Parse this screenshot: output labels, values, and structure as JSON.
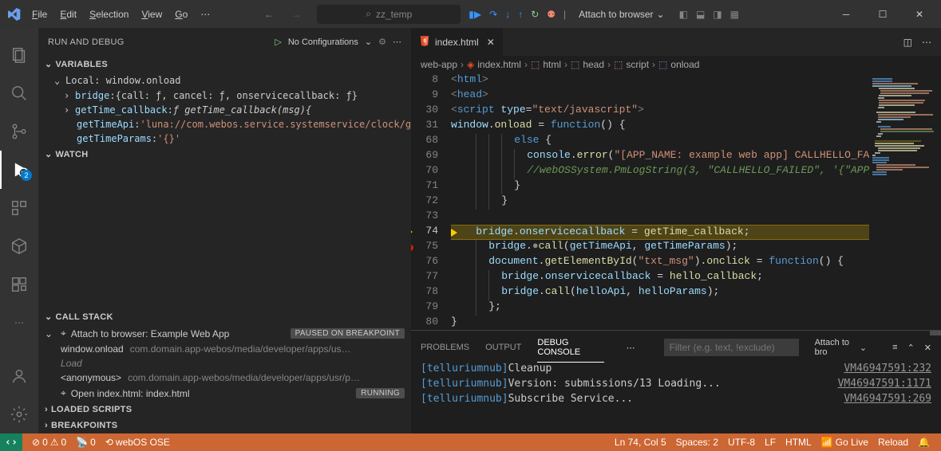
{
  "menu": {
    "file": "File",
    "edit": "Edit",
    "selection": "Selection",
    "view": "View",
    "go": "Go"
  },
  "search_placeholder": "zz_temp",
  "attach_label": "Attach to browser",
  "sidebar": {
    "title": "RUN AND DEBUG",
    "no_config": "No Configurations",
    "sections": {
      "variables": "VARIABLES",
      "watch": "WATCH",
      "callstack": "CALL STACK",
      "loaded_scripts": "LOADED SCRIPTS",
      "breakpoints": "BREAKPOINTS"
    },
    "scope": "Local: window.onload",
    "vars": [
      {
        "name": "bridge",
        "val": "{call: ƒ, cancel: ƒ, onservicecallback: ƒ}",
        "expandable": true
      },
      {
        "name": "getTime_callback",
        "val": "ƒ getTime_callback(msg){",
        "expandable": true
      },
      {
        "name": "getTimeApi",
        "val": "'luna://com.webos.service.systemservice/clock/g…",
        "indent": true,
        "str": true
      },
      {
        "name": "getTimeParams",
        "val": "'{}'",
        "indent": true,
        "str": true
      }
    ],
    "callstack": {
      "target": "Attach to browser: Example Web App",
      "badge": "PAUSED ON BREAKPOINT",
      "frames": [
        {
          "fn": "window.onload",
          "loc": "com.domain.app-webos/media/developer/apps/us…"
        },
        {
          "fn": "Load",
          "em": true
        },
        {
          "fn": "<anonymous>",
          "loc": "com.domain.app-webos/media/developer/apps/usr/p…"
        }
      ],
      "open_label": "Open index.html: index.html",
      "running_badge": "RUNNING"
    }
  },
  "tab": {
    "name": "index.html"
  },
  "breadcrumb": [
    "web-app",
    "index.html",
    "html",
    "head",
    "script",
    "onload"
  ],
  "code": {
    "line_nums": [
      "8",
      "9",
      "30",
      "31",
      "68",
      "69",
      "70",
      "71",
      "72",
      "73",
      "74",
      "75",
      "76",
      "77",
      "78",
      "79",
      "80"
    ],
    "current_line": "74"
  },
  "panel": {
    "tabs": {
      "problems": "PROBLEMS",
      "output": "OUTPUT",
      "debug_console": "DEBUG CONSOLE"
    },
    "filter_placeholder": "Filter (e.g. text, !exclude)",
    "attach_sel": "Attach to bro",
    "console": [
      {
        "tag": "[telluriumnub]",
        "msg": " Cleanup",
        "loc": "VM46947591:232"
      },
      {
        "tag": "[telluriumnub]",
        "msg": " Version: submissions/13 Loading...",
        "loc": "VM46947591:1171"
      },
      {
        "tag": "[telluriumnub]",
        "msg": " Subscribe Service...",
        "loc": "VM46947591:269"
      }
    ]
  },
  "status": {
    "errors": "0",
    "warnings": "0",
    "ports": "0",
    "host": "webOS OSE",
    "pos": "Ln 74, Col 5",
    "spaces": "Spaces: 2",
    "enc": "UTF-8",
    "eol": "LF",
    "lang": "HTML",
    "golive": "Go Live",
    "reload": "Reload"
  }
}
